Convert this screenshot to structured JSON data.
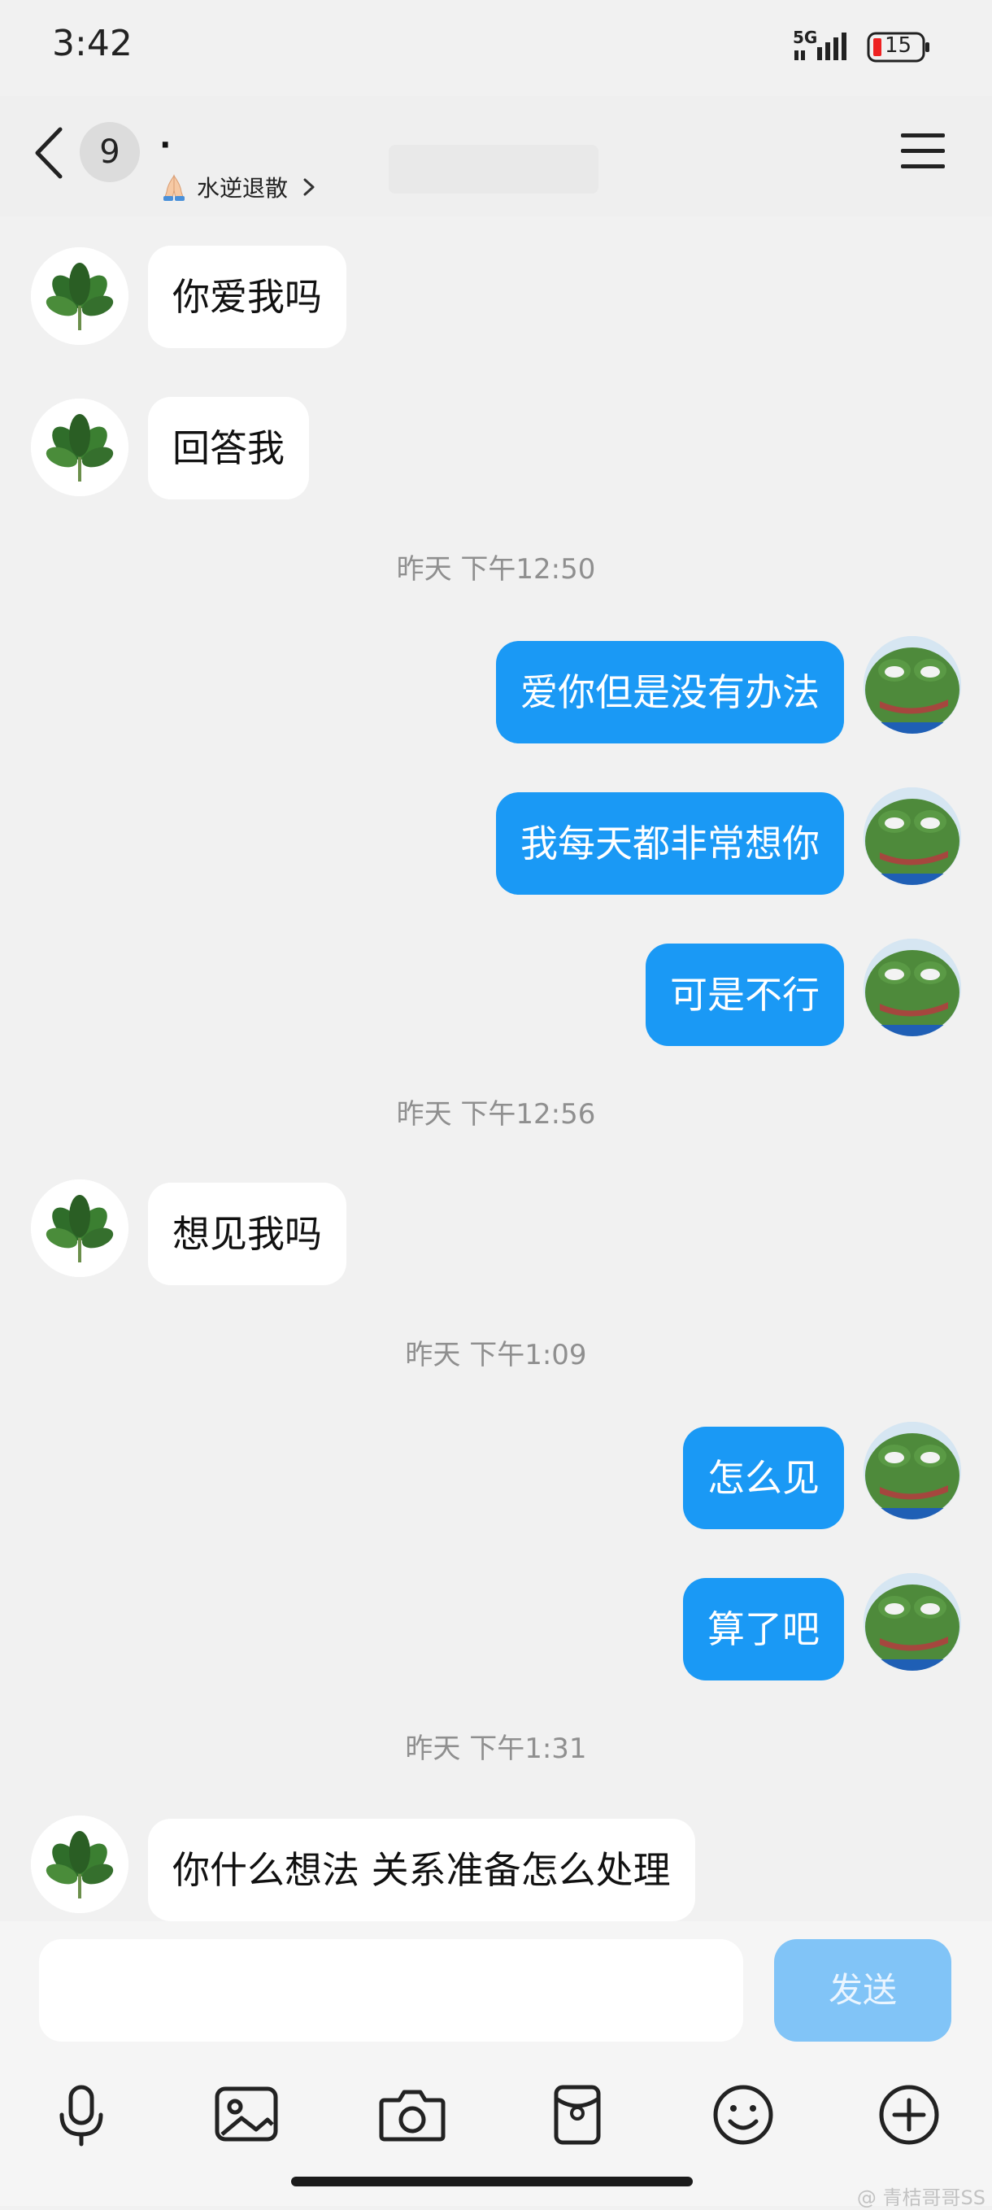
{
  "status_bar": {
    "time": "3:42",
    "network": "5G",
    "battery": "15"
  },
  "header": {
    "unread_count": "9",
    "title": "·",
    "status_text": "水逆退散"
  },
  "messages": [
    {
      "dir": "in",
      "text": "你爱我吗"
    },
    {
      "dir": "in",
      "text": "回答我"
    },
    {
      "type": "time",
      "text": "昨天 下午12:50"
    },
    {
      "dir": "out",
      "text": "爱你但是没有办法"
    },
    {
      "dir": "out",
      "text": "我每天都非常想你"
    },
    {
      "dir": "out",
      "text": "可是不行"
    },
    {
      "type": "time",
      "text": "昨天 下午12:56"
    },
    {
      "dir": "in",
      "text": "想见我吗"
    },
    {
      "type": "time",
      "text": "昨天 下午1:09"
    },
    {
      "dir": "out",
      "text": "怎么见"
    },
    {
      "dir": "out",
      "text": "算了吧"
    },
    {
      "type": "time",
      "text": "昨天 下午1:31"
    },
    {
      "dir": "in",
      "text": "你什么想法 关系准备怎么处理"
    }
  ],
  "input": {
    "placeholder": "",
    "send_label": "发送"
  },
  "toolbar": [
    "mic-icon",
    "image-icon",
    "camera-icon",
    "red-packet-icon",
    "emoji-icon",
    "plus-icon"
  ],
  "watermark": "@ 青桔哥哥SS",
  "colors": {
    "out_bubble": "#1a99f5",
    "send_disabled": "#81c4f7",
    "background": "#f1f1f1"
  }
}
